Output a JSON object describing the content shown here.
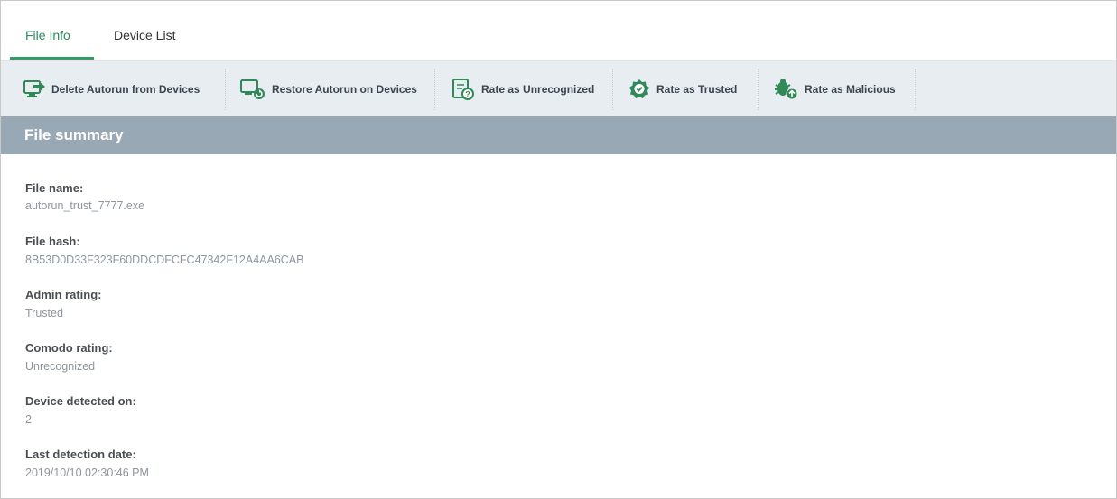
{
  "tabs": [
    {
      "label": "File Info",
      "active": true
    },
    {
      "label": "Device List",
      "active": false
    }
  ],
  "toolbar": {
    "buttons": [
      {
        "label": "Delete Autorun from Devices",
        "icon": "delete-autorun-icon"
      },
      {
        "label": "Restore Autorun on Devices",
        "icon": "restore-autorun-icon"
      },
      {
        "label": "Rate as Unrecognized",
        "icon": "unrecognized-icon"
      },
      {
        "label": "Rate as Trusted",
        "icon": "trusted-badge-icon"
      },
      {
        "label": "Rate as Malicious",
        "icon": "malicious-bug-icon"
      }
    ]
  },
  "section": {
    "title": "File summary"
  },
  "fields": [
    {
      "label": "File name:",
      "value": "autorun_trust_7777.exe"
    },
    {
      "label": "File hash:",
      "value": "8B53D0D33F323F60DDCDFCFC47342F12A4AA6CAB"
    },
    {
      "label": "Admin rating:",
      "value": "Trusted"
    },
    {
      "label": "Comodo rating:",
      "value": "Unrecognized"
    },
    {
      "label": "Device detected on:",
      "value": "2"
    },
    {
      "label": "Last detection date:",
      "value": "2019/10/10 02:30:46 PM"
    }
  ],
  "colors": {
    "accent_green": "#2f9e5f",
    "toolbar_bg": "#e8edf1",
    "section_bar_bg": "#98a8b5"
  }
}
